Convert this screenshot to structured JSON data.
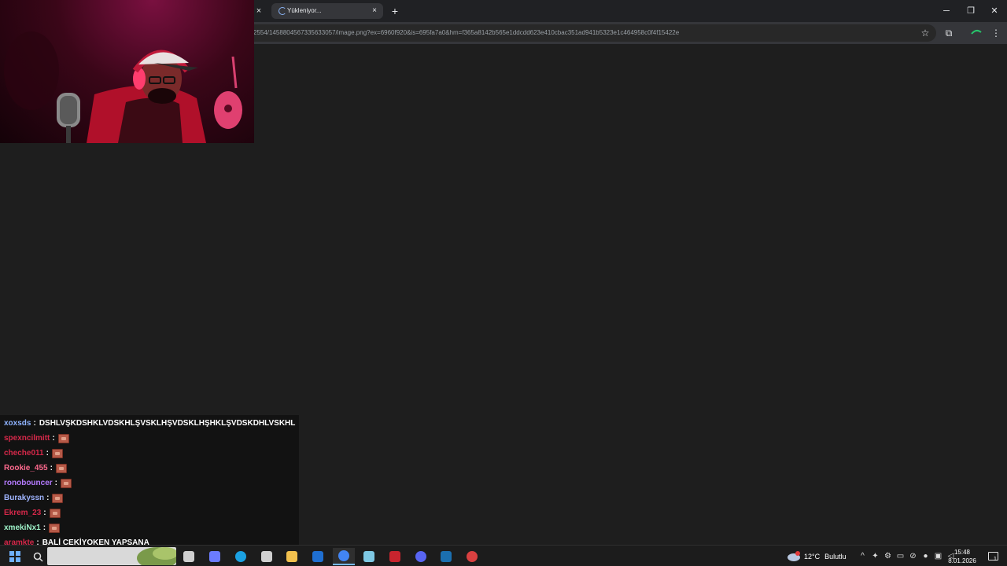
{
  "browser": {
    "active_tab_title": "Yükleniyor...",
    "url": "2554/1458804567335633057/image.png?ex=6960f920&is=695fa7a0&hm=f365a8142b565e1ddcdd623e410cbac351ad941b5323e1c464958c0f4f15422e",
    "icons": {
      "prev_tab_close": "×",
      "tab_close": "×",
      "new_tab": "+",
      "minimize": "─",
      "maximize": "❐",
      "close": "✕",
      "bookmark": "☆",
      "extensions": "⧉",
      "menu": "⋮"
    }
  },
  "chat": {
    "messages": [
      {
        "user": "xoxsds",
        "color": "#8fb3ff",
        "text": "DSHLVŞKDSHKLVDSKHLŞVSKLHŞVDSKLHŞHKLŞVDSKDHLVSKHL",
        "emote": false
      },
      {
        "user": "spexncilmitt",
        "color": "#d6284a",
        "text": "",
        "emote": true
      },
      {
        "user": "cheche011",
        "color": "#d6284a",
        "text": "",
        "emote": true
      },
      {
        "user": "Rookie_455",
        "color": "#ff6a8e",
        "text": "",
        "emote": true
      },
      {
        "user": "ronobouncer",
        "color": "#b57bff",
        "text": "",
        "emote": true
      },
      {
        "user": "Burakyssn",
        "color": "#9fb4ff",
        "text": "",
        "emote": true
      },
      {
        "user": "Ekrem_23",
        "color": "#d6284a",
        "text": "",
        "emote": true
      },
      {
        "user": "xmekiNx1",
        "color": "#9ef2c8",
        "text": "",
        "emote": true
      },
      {
        "user": "aramkte",
        "color": "#d6284a",
        "text": "BALİ ÇEKİYOKEN YAPSANA",
        "emote": false
      }
    ],
    "separator": ":"
  },
  "taskbar": {
    "weather_temp": "12°C",
    "weather_text": "Bulutlu",
    "time": "15:48",
    "date": "8.01.2026",
    "notification_count": "1",
    "apps": [
      {
        "name": "task-view",
        "color": "#cfcfcf"
      },
      {
        "name": "copilot",
        "color": "#6b7cff"
      },
      {
        "name": "edge",
        "color": "#1ba1e2"
      },
      {
        "name": "store",
        "color": "#d0d0d0"
      },
      {
        "name": "file-explorer",
        "color": "#f2c14e"
      },
      {
        "name": "outlook",
        "color": "#1f6fd1"
      },
      {
        "name": "chrome",
        "color": "#4285f4"
      },
      {
        "name": "notepad",
        "color": "#7ec8e3"
      },
      {
        "name": "voicemeeter",
        "color": "#c8242e"
      },
      {
        "name": "discord",
        "color": "#5865f2"
      },
      {
        "name": "steam",
        "color": "#1b6fb0"
      },
      {
        "name": "obs",
        "color": "#d94040"
      }
    ]
  }
}
